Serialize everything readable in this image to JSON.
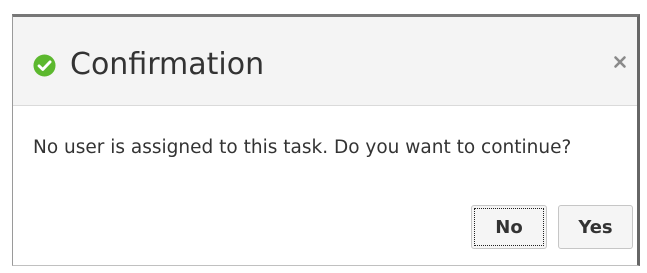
{
  "dialog": {
    "title": "Confirmation",
    "title_icon": "check-circle-icon",
    "close_icon": "close-icon",
    "message": "No user is assigned to this task. Do you want to continue?",
    "buttons": {
      "no_label": "No",
      "yes_label": "Yes"
    }
  },
  "colors": {
    "success_green": "#5cb82e",
    "header_bg": "#f4f4f4",
    "text": "#333333"
  }
}
